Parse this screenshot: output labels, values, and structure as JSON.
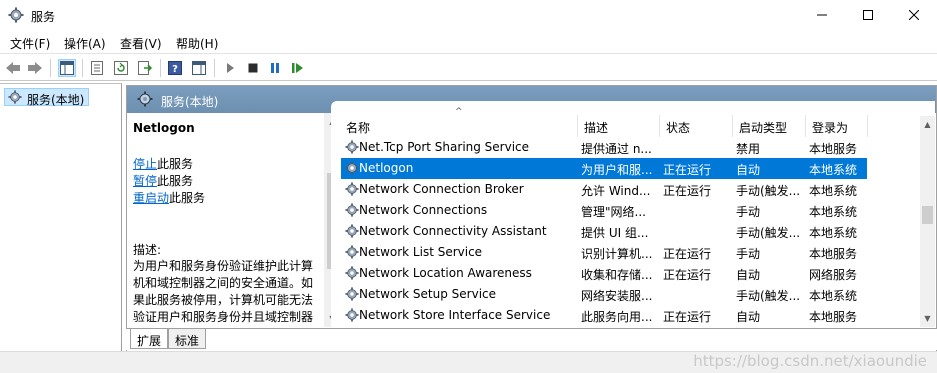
{
  "window": {
    "title": "服务",
    "minimize_icon": "minimize-icon",
    "maximize_icon": "maximize-icon",
    "close_icon": "close-icon"
  },
  "menu": [
    "文件(F)",
    "操作(A)",
    "查看(V)",
    "帮助(H)"
  ],
  "tree": {
    "item": "服务(本地)"
  },
  "content_header": "服务(本地)",
  "desc": {
    "title": "Netlogon",
    "stop_link": "停止",
    "stop_rest": "此服务",
    "pause_link": "暂停",
    "pause_rest": "此服务",
    "restart_link": "重启动",
    "restart_rest": "此服务",
    "label": "描述:",
    "line1": "为用户和服务身份验证维护此计算",
    "line2": "机和域控制器之间的安全通道。如",
    "line3": "果此服务被停用，计算机可能无法",
    "line4": "验证用户和服务身份并且域控制器"
  },
  "columns": {
    "name": "名称",
    "desc": "描述",
    "status": "状态",
    "startup": "启动类型",
    "logon": "登录为"
  },
  "rows": [
    {
      "name": "Net.Tcp Port Sharing Service",
      "desc": "提供通过 n...",
      "status": "",
      "startup": "禁用",
      "logon": "本地服务"
    },
    {
      "name": "Netlogon",
      "desc": "为用户和服...",
      "status": "正在运行",
      "startup": "自动",
      "logon": "本地系统"
    },
    {
      "name": "Network Connection Broker",
      "desc": "允许 Wind...",
      "status": "正在运行",
      "startup": "手动(触发...",
      "logon": "本地系统"
    },
    {
      "name": "Network Connections",
      "desc": "管理\"网络...",
      "status": "",
      "startup": "手动",
      "logon": "本地系统"
    },
    {
      "name": "Network Connectivity Assistant",
      "desc": "提供 UI 组...",
      "status": "",
      "startup": "手动(触发...",
      "logon": "本地系统"
    },
    {
      "name": "Network List Service",
      "desc": "识别计算机...",
      "status": "正在运行",
      "startup": "手动",
      "logon": "本地服务"
    },
    {
      "name": "Network Location Awareness",
      "desc": "收集和存储...",
      "status": "正在运行",
      "startup": "自动",
      "logon": "网络服务"
    },
    {
      "name": "Network Setup Service",
      "desc": "网络安装服...",
      "status": "",
      "startup": "手动(触发...",
      "logon": "本地系统"
    },
    {
      "name": "Network Store Interface Service",
      "desc": "此服务向用...",
      "status": "正在运行",
      "startup": "自动",
      "logon": "本地服务"
    }
  ],
  "tabs": [
    "扩展",
    "标准"
  ],
  "watermark": "https://blog.csdn.net/xiaoundie",
  "colors": {
    "selection": "#0078d7",
    "header": "#7c9ebe",
    "link": "#0066cc"
  }
}
